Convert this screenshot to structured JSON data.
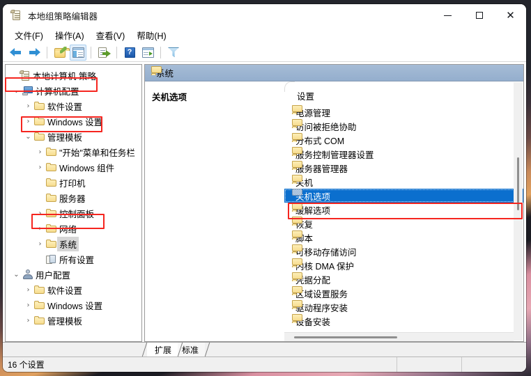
{
  "window": {
    "title": "本地组策略编辑器",
    "app_icon": "policy-document-icon",
    "controls": {
      "minimize": "−",
      "maximize": "□",
      "close": "✕"
    }
  },
  "menubar": {
    "items": [
      {
        "name": "file",
        "text": "文件(F)",
        "label": "文件",
        "accel": "F"
      },
      {
        "name": "action",
        "text": "操作(A)",
        "label": "操作",
        "accel": "A"
      },
      {
        "name": "view",
        "text": "查看(V)",
        "label": "查看",
        "accel": "V"
      },
      {
        "name": "help",
        "text": "帮助(H)",
        "label": "帮助",
        "accel": "H"
      }
    ]
  },
  "toolbar": {
    "buttons": [
      {
        "name": "back-arrow-icon",
        "selected": false
      },
      {
        "name": "forward-arrow-icon",
        "selected": false
      },
      {
        "name": "up-folder-icon",
        "selected": false
      },
      {
        "name": "show-console-tree-icon",
        "selected": true
      },
      {
        "name": "export-list-icon",
        "selected": false
      },
      {
        "name": "help-icon",
        "selected": false,
        "glyph": "?"
      },
      {
        "name": "properties-icon",
        "selected": false
      },
      {
        "name": "filter-icon",
        "selected": false
      }
    ]
  },
  "tree": {
    "root": {
      "label": "本地计算机 策略",
      "icon": "policy-document-icon"
    },
    "items": [
      {
        "label": "计算机配置",
        "icon": "computer-icon",
        "twisty": "expanded",
        "indent": 1,
        "highlighted": false
      },
      {
        "label": "软件设置",
        "icon": "folder-icon",
        "twisty": "collapsed",
        "indent": 2,
        "highlighted": false
      },
      {
        "label": "Windows 设置",
        "icon": "folder-icon",
        "twisty": "collapsed",
        "indent": 2,
        "highlighted": false
      },
      {
        "label": "管理模板",
        "icon": "folder-icon",
        "twisty": "expanded",
        "indent": 2,
        "highlighted": false
      },
      {
        "label": "\"开始\"菜单和任务栏",
        "icon": "folder-icon",
        "twisty": "collapsed",
        "indent": 3,
        "highlighted": false
      },
      {
        "label": "Windows 组件",
        "icon": "folder-icon",
        "twisty": "collapsed",
        "indent": 3,
        "highlighted": false
      },
      {
        "label": "打印机",
        "icon": "folder-icon",
        "twisty": "none",
        "indent": 3,
        "highlighted": false
      },
      {
        "label": "服务器",
        "icon": "folder-icon",
        "twisty": "none",
        "indent": 3,
        "highlighted": false
      },
      {
        "label": "控制面板",
        "icon": "folder-icon",
        "twisty": "collapsed",
        "indent": 3,
        "highlighted": false
      },
      {
        "label": "网络",
        "icon": "folder-icon",
        "twisty": "collapsed",
        "indent": 3,
        "highlighted": false
      },
      {
        "label": "系统",
        "icon": "folder-icon",
        "twisty": "collapsed",
        "indent": 3,
        "highlighted": true
      },
      {
        "label": "所有设置",
        "icon": "all-settings-icon",
        "twisty": "none",
        "indent": 3,
        "highlighted": false
      },
      {
        "label": "用户配置",
        "icon": "user-icon",
        "twisty": "expanded",
        "indent": 1,
        "highlighted": false
      },
      {
        "label": "软件设置",
        "icon": "folder-icon",
        "twisty": "collapsed",
        "indent": 2,
        "highlighted": false
      },
      {
        "label": "Windows 设置",
        "icon": "folder-icon",
        "twisty": "collapsed",
        "indent": 2,
        "highlighted": false
      },
      {
        "label": "管理模板",
        "icon": "folder-icon",
        "twisty": "collapsed",
        "indent": 2,
        "highlighted": false
      }
    ]
  },
  "right_panel": {
    "header": {
      "label": "系统",
      "icon": "folder-icon"
    },
    "detail_title": "关机选项",
    "list_header": "设置",
    "items": [
      {
        "label": "电源管理",
        "selected": false
      },
      {
        "label": "访问被拒绝协助",
        "selected": false
      },
      {
        "label": "分布式 COM",
        "selected": false
      },
      {
        "label": "服务控制管理器设置",
        "selected": false
      },
      {
        "label": "服务器管理器",
        "selected": false
      },
      {
        "label": "关机",
        "selected": false
      },
      {
        "label": "关机选项",
        "selected": true
      },
      {
        "label": "缓解选项",
        "selected": false
      },
      {
        "label": "恢复",
        "selected": false
      },
      {
        "label": "脚本",
        "selected": false
      },
      {
        "label": "可移动存储访问",
        "selected": false
      },
      {
        "label": "内核 DMA 保护",
        "selected": false
      },
      {
        "label": "凭据分配",
        "selected": false
      },
      {
        "label": "区域设置服务",
        "selected": false
      },
      {
        "label": "驱动程序安装",
        "selected": false
      },
      {
        "label": "设备安装",
        "selected": false
      }
    ]
  },
  "tabs": [
    {
      "label": "扩展",
      "active": true
    },
    {
      "label": "标准",
      "active": false
    }
  ],
  "statusbar": {
    "text": "16 个设置"
  },
  "annotations": {
    "color": "#f5251f",
    "boxes": [
      {
        "name": "annotation-computer-config",
        "target": "计算机配置"
      },
      {
        "name": "annotation-admin-templates",
        "target": "管理模板"
      },
      {
        "name": "annotation-system-node",
        "target": "系统"
      },
      {
        "name": "annotation-shutdown-options",
        "target": "关机选项"
      }
    ]
  }
}
